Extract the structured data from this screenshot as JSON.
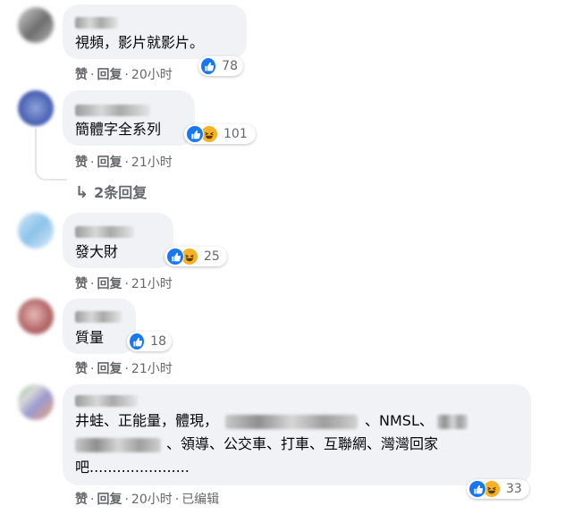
{
  "comments": [
    {
      "text": "視頻，影片就影片。",
      "like_label": "赞",
      "reply_label": "回复",
      "time": "20小时",
      "reaction_count": "78"
    },
    {
      "text": "簡體字全系列",
      "like_label": "赞",
      "reply_label": "回复",
      "time": "21小时",
      "reaction_count": "101",
      "replies_label": "2条回复"
    },
    {
      "text": "發大財",
      "like_label": "赞",
      "reply_label": "回复",
      "time": "21小时",
      "reaction_count": "25"
    },
    {
      "text": "質量",
      "like_label": "赞",
      "reply_label": "回复",
      "time": "21小时",
      "reaction_count": "18"
    },
    {
      "text_parts": [
        "井蛙、正能量，體現，",
        "、NMSL、",
        "、領導、公交車、打車、互聯網、灣灣回家",
        "吧......................"
      ],
      "like_label": "赞",
      "reply_label": "回复",
      "time": "20小时",
      "edited": "已编辑",
      "reaction_count": "33"
    }
  ],
  "colors": {
    "bubble": "#f0f2f5",
    "meta_text": "#65676b",
    "like_blue": "#1877f2",
    "haha_yellow": "#f7b125"
  }
}
